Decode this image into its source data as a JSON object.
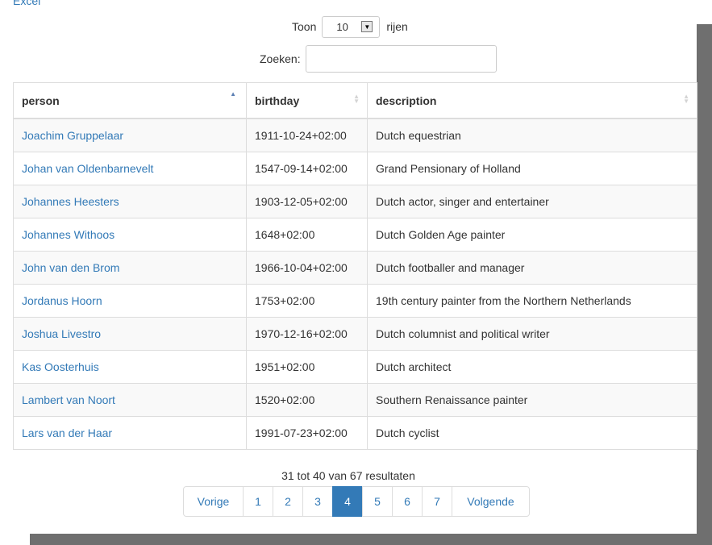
{
  "export": {
    "excel_label": "Excel"
  },
  "length_control": {
    "prefix": "Toon",
    "value": "10",
    "suffix": "rijen"
  },
  "search": {
    "label": "Zoeken:",
    "value": ""
  },
  "table": {
    "columns": [
      "person",
      "birthday",
      "description"
    ],
    "sorted_column": "person",
    "sort_direction": "ascending",
    "rows": [
      {
        "person": "Joachim Gruppelaar",
        "birthday": "1911-10-24+02:00",
        "description": "Dutch equestrian"
      },
      {
        "person": "Johan van Oldenbarnevelt",
        "birthday": "1547-09-14+02:00",
        "description": "Grand Pensionary of Holland"
      },
      {
        "person": "Johannes Heesters",
        "birthday": "1903-12-05+02:00",
        "description": "Dutch actor, singer and entertainer"
      },
      {
        "person": "Johannes Withoos",
        "birthday": "1648+02:00",
        "description": "Dutch Golden Age painter"
      },
      {
        "person": "John van den Brom",
        "birthday": "1966-10-04+02:00",
        "description": "Dutch footballer and manager"
      },
      {
        "person": "Jordanus Hoorn",
        "birthday": "1753+02:00",
        "description": "19th century painter from the Northern Netherlands"
      },
      {
        "person": "Joshua Livestro",
        "birthday": "1970-12-16+02:00",
        "description": "Dutch columnist and political writer"
      },
      {
        "person": "Kas Oosterhuis",
        "birthday": "1951+02:00",
        "description": "Dutch architect"
      },
      {
        "person": "Lambert van Noort",
        "birthday": "1520+02:00",
        "description": "Southern Renaissance painter"
      },
      {
        "person": "Lars van der Haar",
        "birthday": "1991-07-23+02:00",
        "description": "Dutch cyclist"
      }
    ]
  },
  "info_text": "31 tot 40 van 67 resultaten",
  "pagination": {
    "previous": "Vorige",
    "next": "Volgende",
    "pages": [
      "1",
      "2",
      "3",
      "4",
      "5",
      "6",
      "7"
    ],
    "current": "4"
  },
  "colors": {
    "link": "#337ab7",
    "active_page": "#337ab7",
    "shadow": "#6f6f6f",
    "row_stripe": "#f9f9f9"
  },
  "icons": {
    "sort_ascending": "triangle-up-icon",
    "sort_both": "sort-arrows-icon",
    "select_arrow": "chevron-down-icon"
  }
}
